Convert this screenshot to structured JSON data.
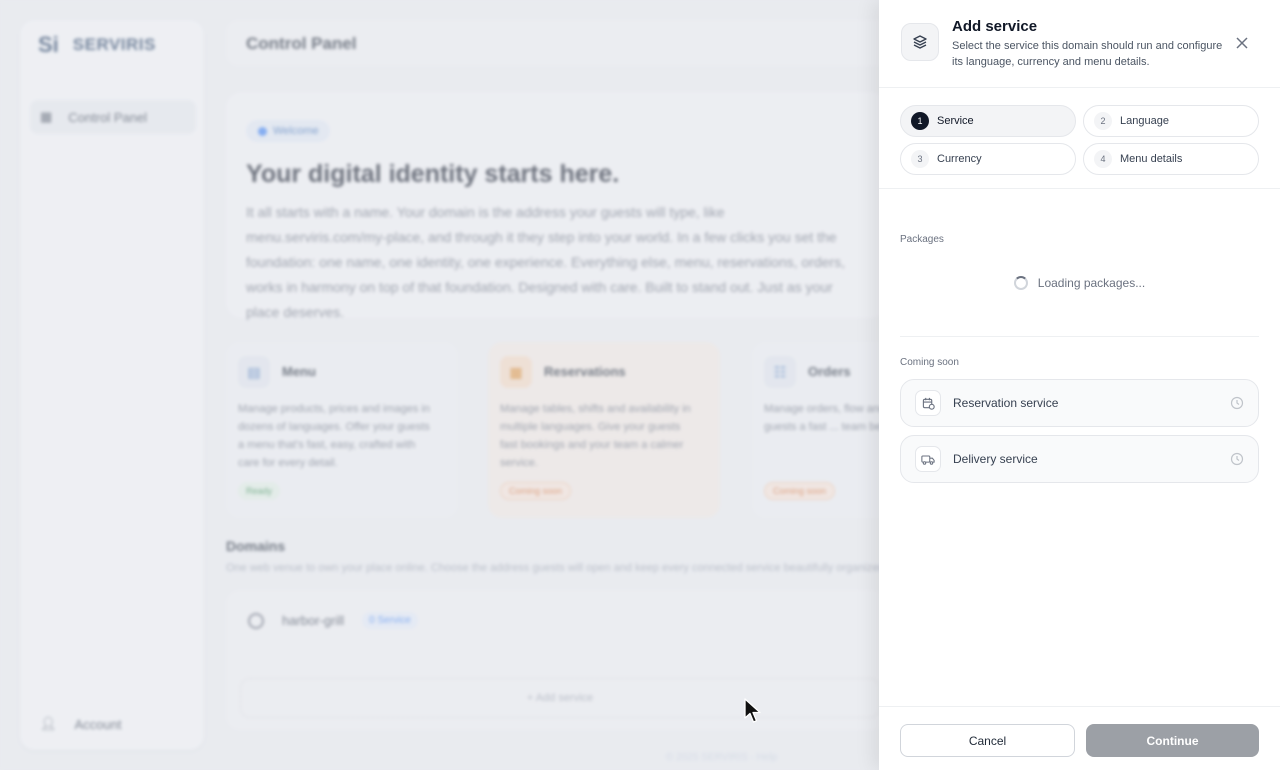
{
  "app": {
    "brand_mark": "Si",
    "brand_name": "SERVIRIS",
    "page_title": "Control Panel"
  },
  "sidebar": {
    "items": [
      {
        "label": "Control Panel",
        "icon": "grid-icon"
      }
    ],
    "account_label": "Account"
  },
  "welcome": {
    "pill": "Welcome",
    "title": "Your digital identity starts here.",
    "text": "It all starts with a name. Your domain is the address your guests will type, like menu.serviris.com/my-place, and through it they step into your world. In a few clicks you set the foundation: one name, one identity, one experience. Everything else, menu, reservations, orders, works in harmony on top of that foundation. Designed with care. Built to stand out. Just as your place deserves."
  },
  "features": [
    {
      "title": "Menu",
      "text": "Manage products, prices and images in dozens of languages. Offer your guests a menu that's fast, easy, crafted with care for every detail.",
      "badge": "Ready",
      "icon": "menu-icon"
    },
    {
      "title": "Reservations",
      "text": "Manage tables, shifts and availability in multiple languages. Give your guests fast bookings and your team a calmer service.",
      "badge": "Coming soon",
      "icon": "calendar-icon"
    },
    {
      "title": "Orders",
      "text": "Manage orders, flow and ... Give your guests a fast ... team better control.",
      "badge": "Coming soon",
      "icon": "orders-icon"
    }
  ],
  "domains": {
    "title": "Domains",
    "subtitle": "One web venue to own your place online. Choose the address guests will open and keep every connected service beautifully organized.",
    "domain_name": "harbor-grill",
    "domain_badge": "0 Service",
    "add_service": "+ Add service",
    "footer": "© 2025 SERVIRIS · Help"
  },
  "drawer": {
    "title": "Add service",
    "description": "Select the service this domain should run and configure its language, currency and menu details.",
    "steps": [
      {
        "num": "1",
        "label": "Service",
        "active": true
      },
      {
        "num": "2",
        "label": "Language",
        "active": false
      },
      {
        "num": "3",
        "label": "Currency",
        "active": false
      },
      {
        "num": "4",
        "label": "Menu details",
        "active": false
      }
    ],
    "packages_label": "Packages",
    "loading_text": "Loading packages...",
    "coming_soon_label": "Coming soon",
    "services": [
      {
        "label": "Reservation service",
        "icon": "calendar-clock-icon"
      },
      {
        "label": "Delivery service",
        "icon": "truck-icon"
      }
    ],
    "cancel_label": "Cancel",
    "continue_label": "Continue"
  },
  "colors": {
    "accent": "#3b82f6",
    "continue_disabled": "#9ca0a6",
    "dark": "#111827"
  }
}
